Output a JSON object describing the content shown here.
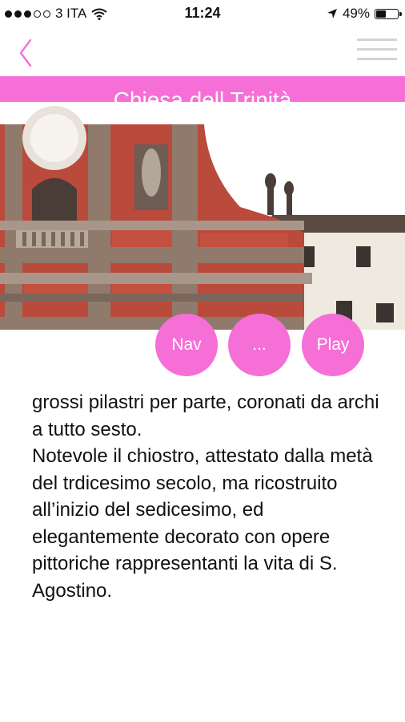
{
  "status_bar": {
    "carrier": "3 ITA",
    "time": "11:24",
    "battery_percent": "49%",
    "battery_level": 0.49,
    "signal_dots_filled": 3,
    "signal_dots_total": 5
  },
  "header": {
    "title": "Chiesa dell Trinità",
    "accent_color": "#f56fd6"
  },
  "actions": {
    "nav_label": "Nav",
    "more_label": "...",
    "play_label": "Play"
  },
  "content": {
    "text": "grossi pilastri per parte, coronati da archi a tutto sesto.\nNotevole il chiostro, attestato dalla metà del trdicesimo secolo, ma ricostruito all’inizio del sedicesimo, ed elegantemente decorato con opere pittoriche rappresentanti la vita di S. Agostino."
  },
  "icons": {
    "back": "chevron-left-icon",
    "menu": "hamburger-menu-icon",
    "wifi": "wifi-icon",
    "location": "location-arrow-icon",
    "battery": "battery-icon"
  }
}
